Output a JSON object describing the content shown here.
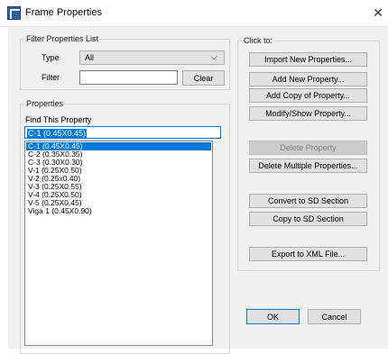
{
  "window": {
    "title": "Frame Properties",
    "close_glyph": "✕"
  },
  "filter_group": {
    "label": "Filter Properties List",
    "type_label": "Type",
    "type_value": "All",
    "filter_label": "Filter",
    "filter_value": "",
    "clear_button": "Clear"
  },
  "properties_group": {
    "label": "Properties",
    "find_label": "Find This Property",
    "find_value": "C-1 (0.45X0.45)",
    "items": [
      "C-1 (0.45X0.45)",
      "C-2 (0.35X0.35)",
      "C-3 (0.30X0.30)",
      "V-1 (0.25X0.50)",
      "V-2  (0.25x0.40)",
      "V-3 (0.25X0.55)",
      "V-4 (0.25X0.50)",
      "V-5 (0.25X0.45)",
      "Viga 1 (0.45X0.90)"
    ],
    "selected_index": 0
  },
  "click_to_group": {
    "label": "Click to:",
    "import_button": "Import New Properties...",
    "add_new_button": "Add New Property...",
    "add_copy_button": "Add Copy of Property...",
    "modify_button": "Modify/Show Property...",
    "delete_button": "Delete Property",
    "delete_multiple_button": "Delete Multiple Properties...",
    "convert_button": "Convert to SD Section",
    "copy_sd_button": "Copy to SD Section",
    "export_button": "Export to XML File..."
  },
  "footer": {
    "ok_button": "OK",
    "cancel_button": "Cancel"
  }
}
